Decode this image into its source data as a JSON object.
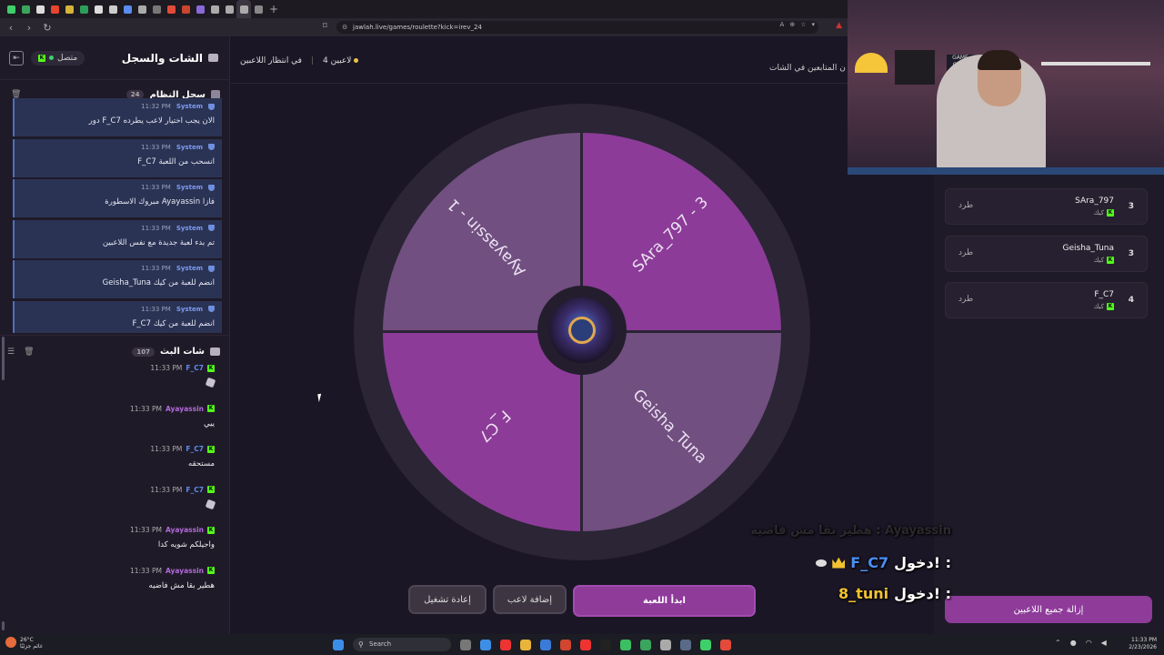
{
  "browser": {
    "url": "jawlah.live/games/roulette?kick=irev_24",
    "tab_colors": [
      "#3ecf6a",
      "#3aa55c",
      "#dddddd",
      "#e8442f",
      "#d4b43a",
      "#2e9e5b",
      "#dddddd",
      "#cccccc",
      "#5a8dee",
      "#aaaaaa",
      "#777777",
      "#e34a3a",
      "#c8452f",
      "#8a6ad8",
      "#aaaaaa",
      "#aaaaaa",
      "#aaaaaa",
      "#888888"
    ]
  },
  "sidebar": {
    "title": "الشات والسجل",
    "status": "متصل",
    "system_log": {
      "title": "سجل النظام",
      "count": "24",
      "messages": [
        {
          "sender": "System",
          "time": "11:32 PM",
          "text": "دور F_C7 الان يجب اختيار لاعب يطرده"
        },
        {
          "sender": "System",
          "time": "11:33 PM",
          "text": "F_C7 انسحب من اللعبة"
        },
        {
          "sender": "System",
          "time": "11:33 PM",
          "text": "مبروك الاسطورة Ayayassin فازا"
        },
        {
          "sender": "System",
          "time": "11:33 PM",
          "text": "تم بدء لعبة جديدة مع نفس اللاعبين"
        },
        {
          "sender": "System",
          "time": "11:33 PM",
          "text": "Geisha_Tuna انضم للعبة من كيك"
        },
        {
          "sender": "System",
          "time": "11:33 PM",
          "text": "F_C7 انضم للعبة من كيك"
        }
      ]
    },
    "stream_chat": {
      "title": "شات البث",
      "count": "107",
      "messages": [
        {
          "name": "F_C7",
          "name_color": "#5b8df0",
          "time": "11:33 PM",
          "text": "",
          "emoji": true
        },
        {
          "name": "Ayayassin",
          "name_color": "#b26ad8",
          "time": "11:33 PM",
          "text": "ييي",
          "emoji": false
        },
        {
          "name": "F_C7",
          "name_color": "#5b8df0",
          "time": "11:33 PM",
          "text": "مستحقه",
          "emoji": false
        },
        {
          "name": "F_C7",
          "name_color": "#5b8df0",
          "time": "11:33 PM",
          "text": "",
          "emoji": true
        },
        {
          "name": "Ayayassin",
          "name_color": "#b26ad8",
          "time": "11:33 PM",
          "text": "واجيلكم شويه كدا",
          "emoji": false
        },
        {
          "name": "Ayayassin",
          "name_color": "#b26ad8",
          "time": "11:33 PM",
          "text": "هطير بقا مش فاضيه",
          "emoji": false
        }
      ]
    }
  },
  "main": {
    "players_count": "4 لاعبين",
    "waiting": "في انتظار اللاعبين",
    "followers_note": "ن المتابعين في الشات",
    "wheel": {
      "segments": [
        {
          "label": "Ayayassin - 1"
        },
        {
          "label": "SAra_797 - 3"
        },
        {
          "label": "F_C7"
        },
        {
          "label": "Geisha_Tuna"
        }
      ]
    },
    "buttons": {
      "reset": "إعادة تشغيل",
      "add_player": "إضافة لاعب",
      "start": "ابدأ اللعبة"
    }
  },
  "players_panel": {
    "players": [
      {
        "name": "SAra_797",
        "platform": "كيك",
        "number": "3",
        "kick_label": "طرد"
      },
      {
        "name": "Geisha_Tuna",
        "platform": "كيك",
        "number": "3",
        "kick_label": "طرد"
      },
      {
        "name": "F_C7",
        "platform": "كيك",
        "number": "4",
        "kick_label": "طرد"
      }
    ],
    "remove_all": "إزالة جميع اللاعبين"
  },
  "overlay": {
    "faded": "هطير بقا مش فاضيه : Ayayassin",
    "line1_text": "دخول! :",
    "line1_name": "F_C7",
    "line1_color": "#4a8ef5",
    "line2_text": "دخول! :",
    "line2_name": "8_tuni",
    "line2_color": "#f2c230"
  },
  "taskbar": {
    "weather_temp": "26°C",
    "weather_desc": "غائم جزئيًا",
    "search": "Search",
    "time": "11:33 PM",
    "date": "2/23/2026"
  }
}
